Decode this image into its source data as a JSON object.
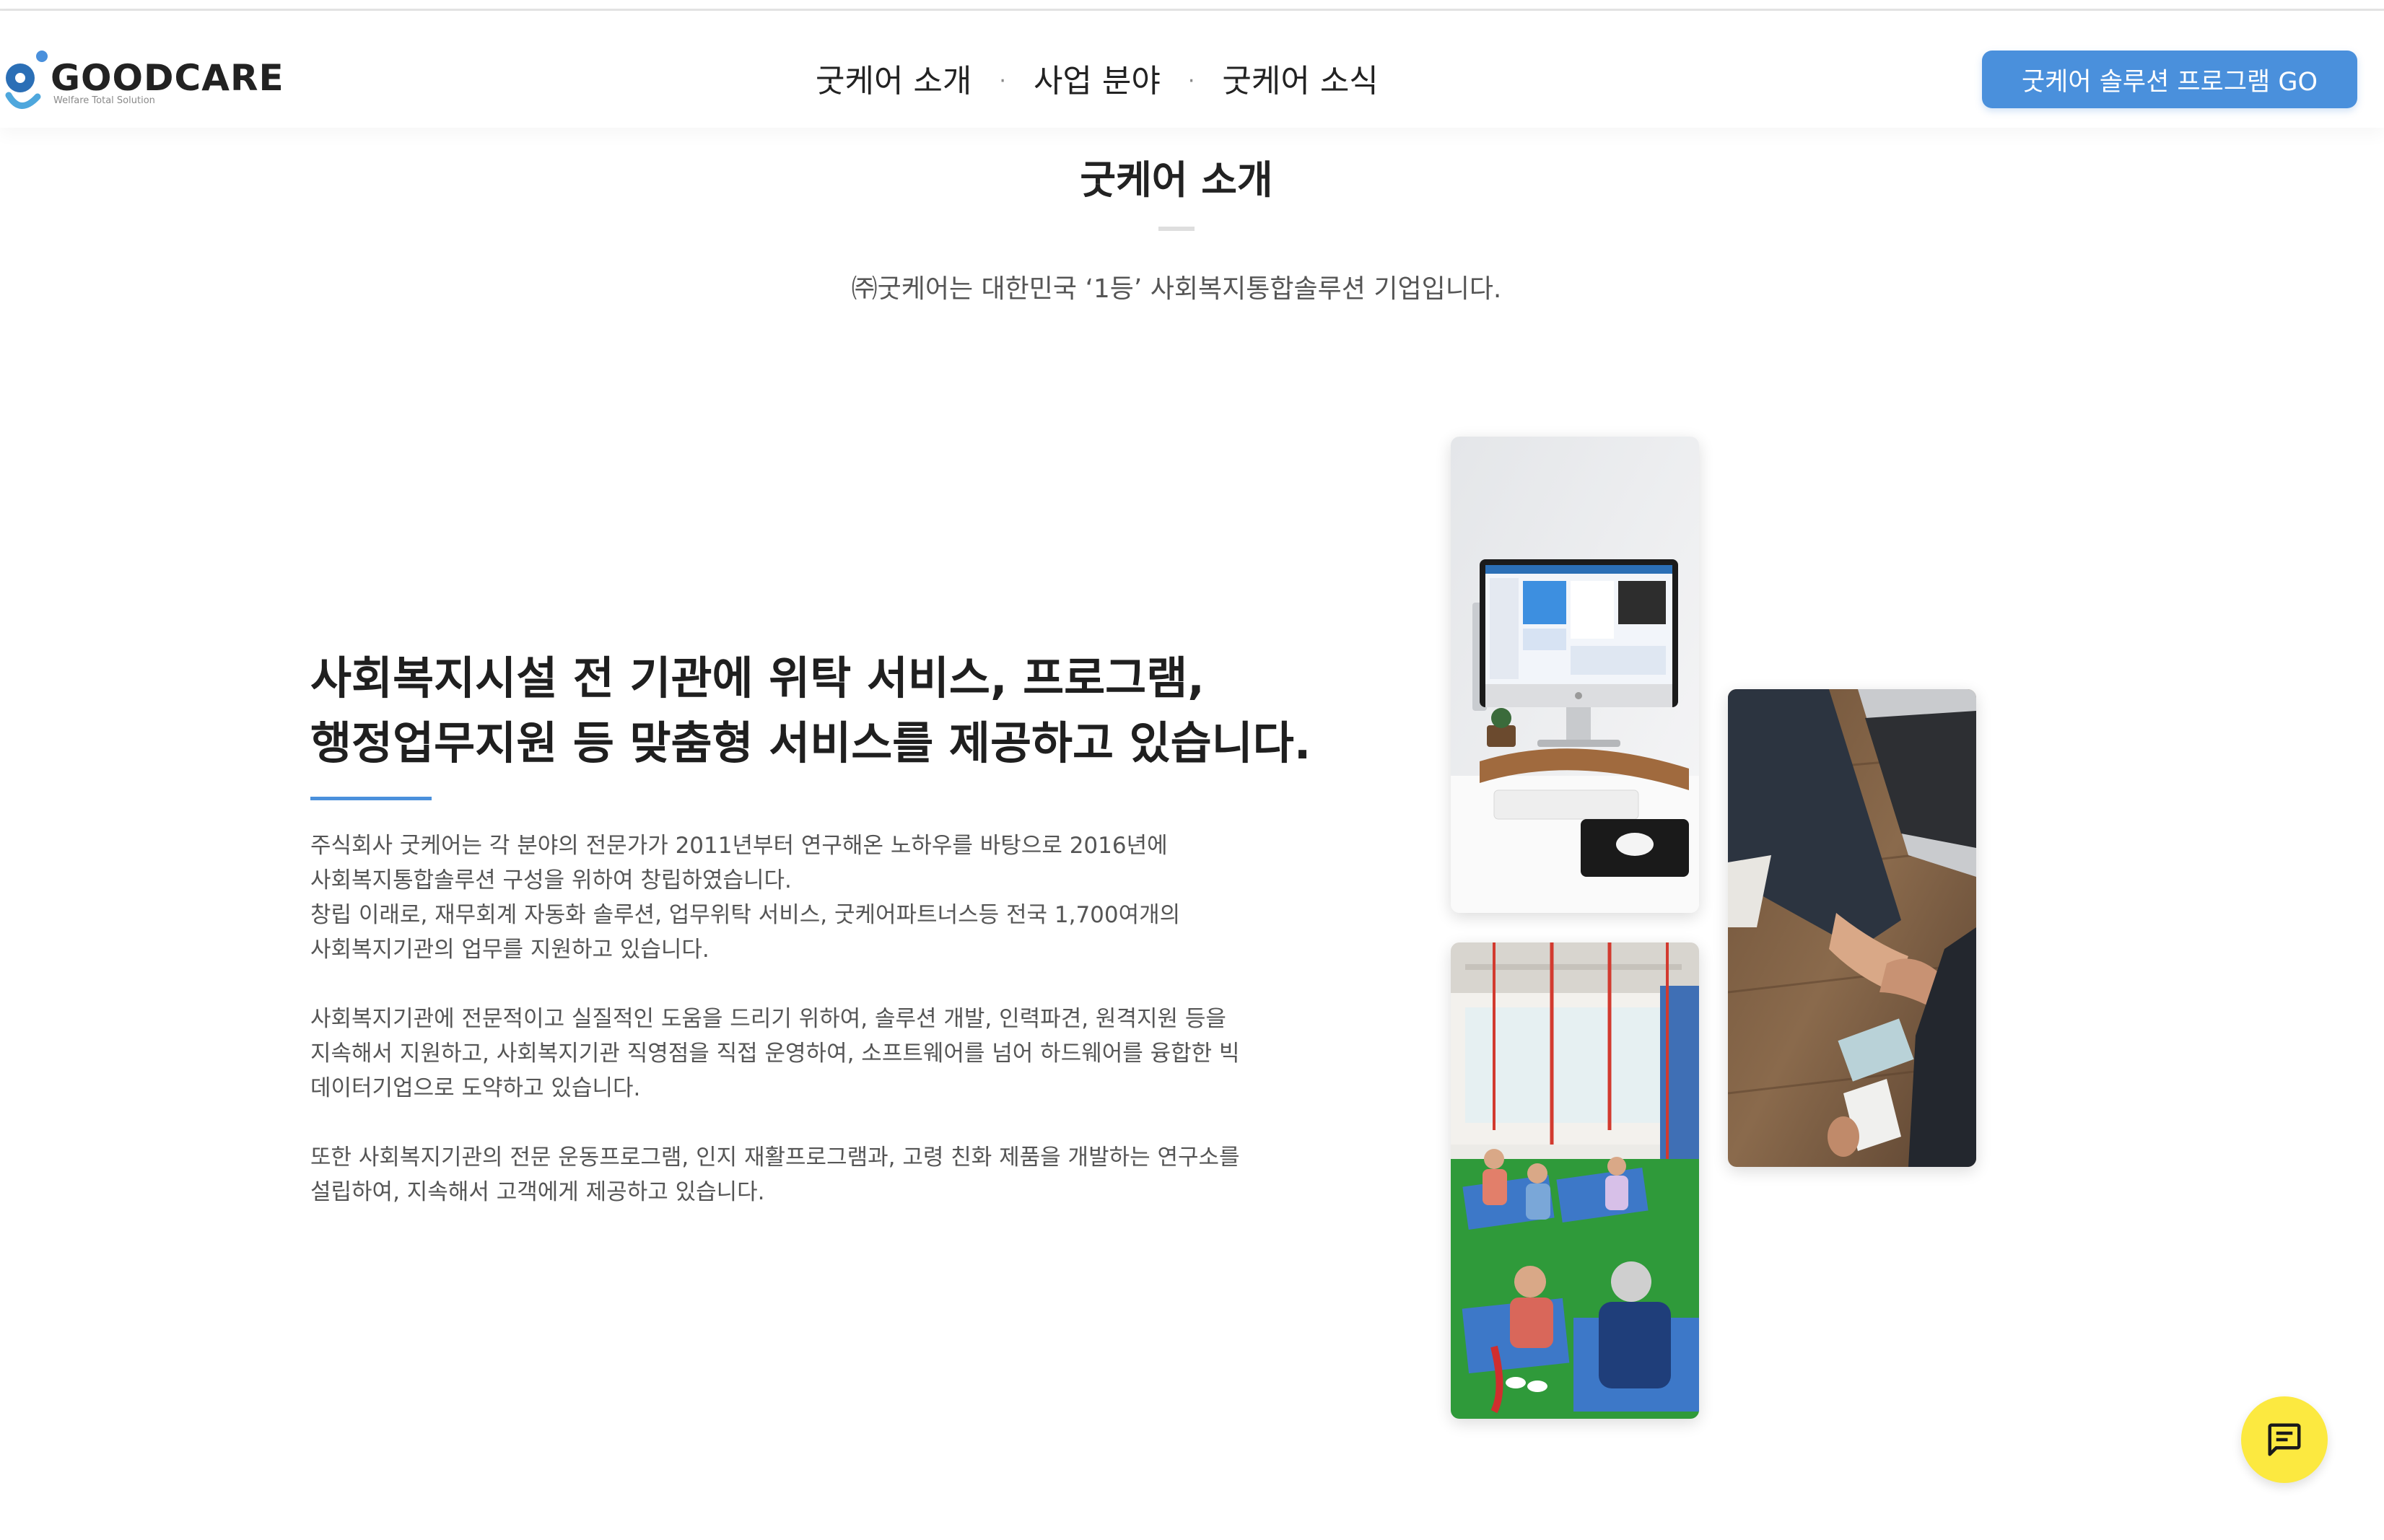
{
  "header": {
    "logo_text": "GOODCARE",
    "logo_sub": "Welfare Total Solution",
    "nav": [
      "굿케어 소개",
      "사업 분야",
      "굿케어 소식"
    ],
    "nav_separator": "·",
    "cta_label": "굿케어 솔루션 프로그램 GO"
  },
  "intro": {
    "title": "굿케어 소개",
    "subtitle": "㈜굿케어는 대한민국 ‘1등’ 사회복지통합솔루션 기업입니다."
  },
  "main": {
    "headline": [
      "사회복지시설 전 기관에 위탁 서비스, 프로그램,",
      "행정업무지원 등 맞춤형 서비스를 제공하고 있습니다."
    ],
    "paragraphs": [
      [
        "주식회사 굿케어는 각 분야의 전문가가 2011년부터 연구해온 노하우를 바탕으로 2016년에",
        "사회복지통합솔루션 구성을 위하여 창립하였습니다.",
        "창립 이래로, 재무회계 자동화 솔루션, 업무위탁 서비스, 굿케어파트너스등 전국 1,700여개의",
        "사회복지기관의 업무를 지원하고 있습니다."
      ],
      [
        "사회복지기관에 전문적이고 실질적인 도움을 드리기 위하여, 솔루션 개발, 인력파견, 원격지원 등을",
        "지속해서 지원하고, 사회복지기관 직영점을 직접 운영하여, 소프트웨어를 넘어 하드웨어를 융합한 빅",
        "데이터기업으로 도약하고 있습니다."
      ],
      [
        "또한 사회복지기관의 전문 운동프로그램, 인지 재활프로그램과, 고령 친화 제품을 개발하는 연구소를",
        "설립하여, 지속해서 고객에게 제공하고 있습니다."
      ]
    ]
  },
  "photos": [
    "computer-desk-photo",
    "handshake-photo",
    "senior-exercise-class-photo"
  ],
  "chat_button_icon": "chat-icon",
  "colors": {
    "accent": "#4a90dc",
    "chat_button": "#fce940",
    "text_dark": "#222222",
    "text_body": "#555555"
  }
}
